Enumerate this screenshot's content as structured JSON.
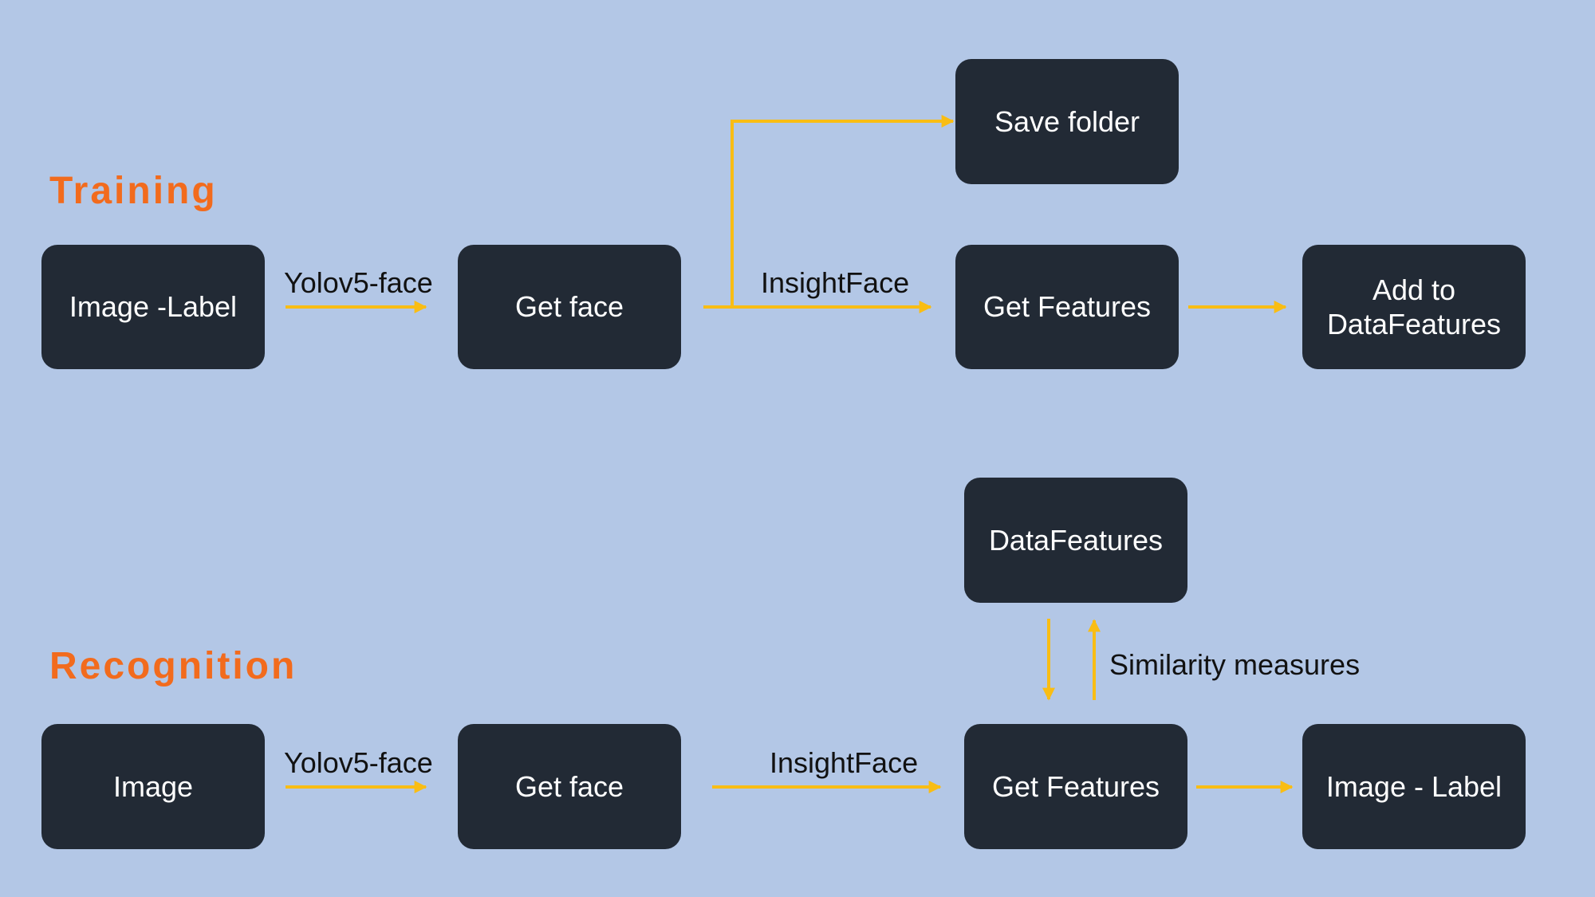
{
  "training": {
    "title": "Training",
    "boxes": {
      "image_label": "Image -Label",
      "get_face": "Get face",
      "save_folder": "Save folder",
      "get_features": "Get Features",
      "add_to_datafeatures": "Add to\nDataFeatures"
    },
    "edges": {
      "detector": "Yolov5-face",
      "extractor": "InsightFace"
    }
  },
  "recognition": {
    "title": "Recognition",
    "boxes": {
      "image": "Image",
      "get_face": "Get face",
      "datafeatures": "DataFeatures",
      "get_features": "Get Features",
      "image_label": "Image - Label"
    },
    "edges": {
      "detector": "Yolov5-face",
      "extractor": "InsightFace",
      "similarity": "Similarity measures"
    }
  },
  "colors": {
    "background": "#b3c7e6",
    "box": "#222a35",
    "box_text": "#ffffff",
    "arrow": "#f9bd14",
    "section_title": "#f26b1d"
  }
}
